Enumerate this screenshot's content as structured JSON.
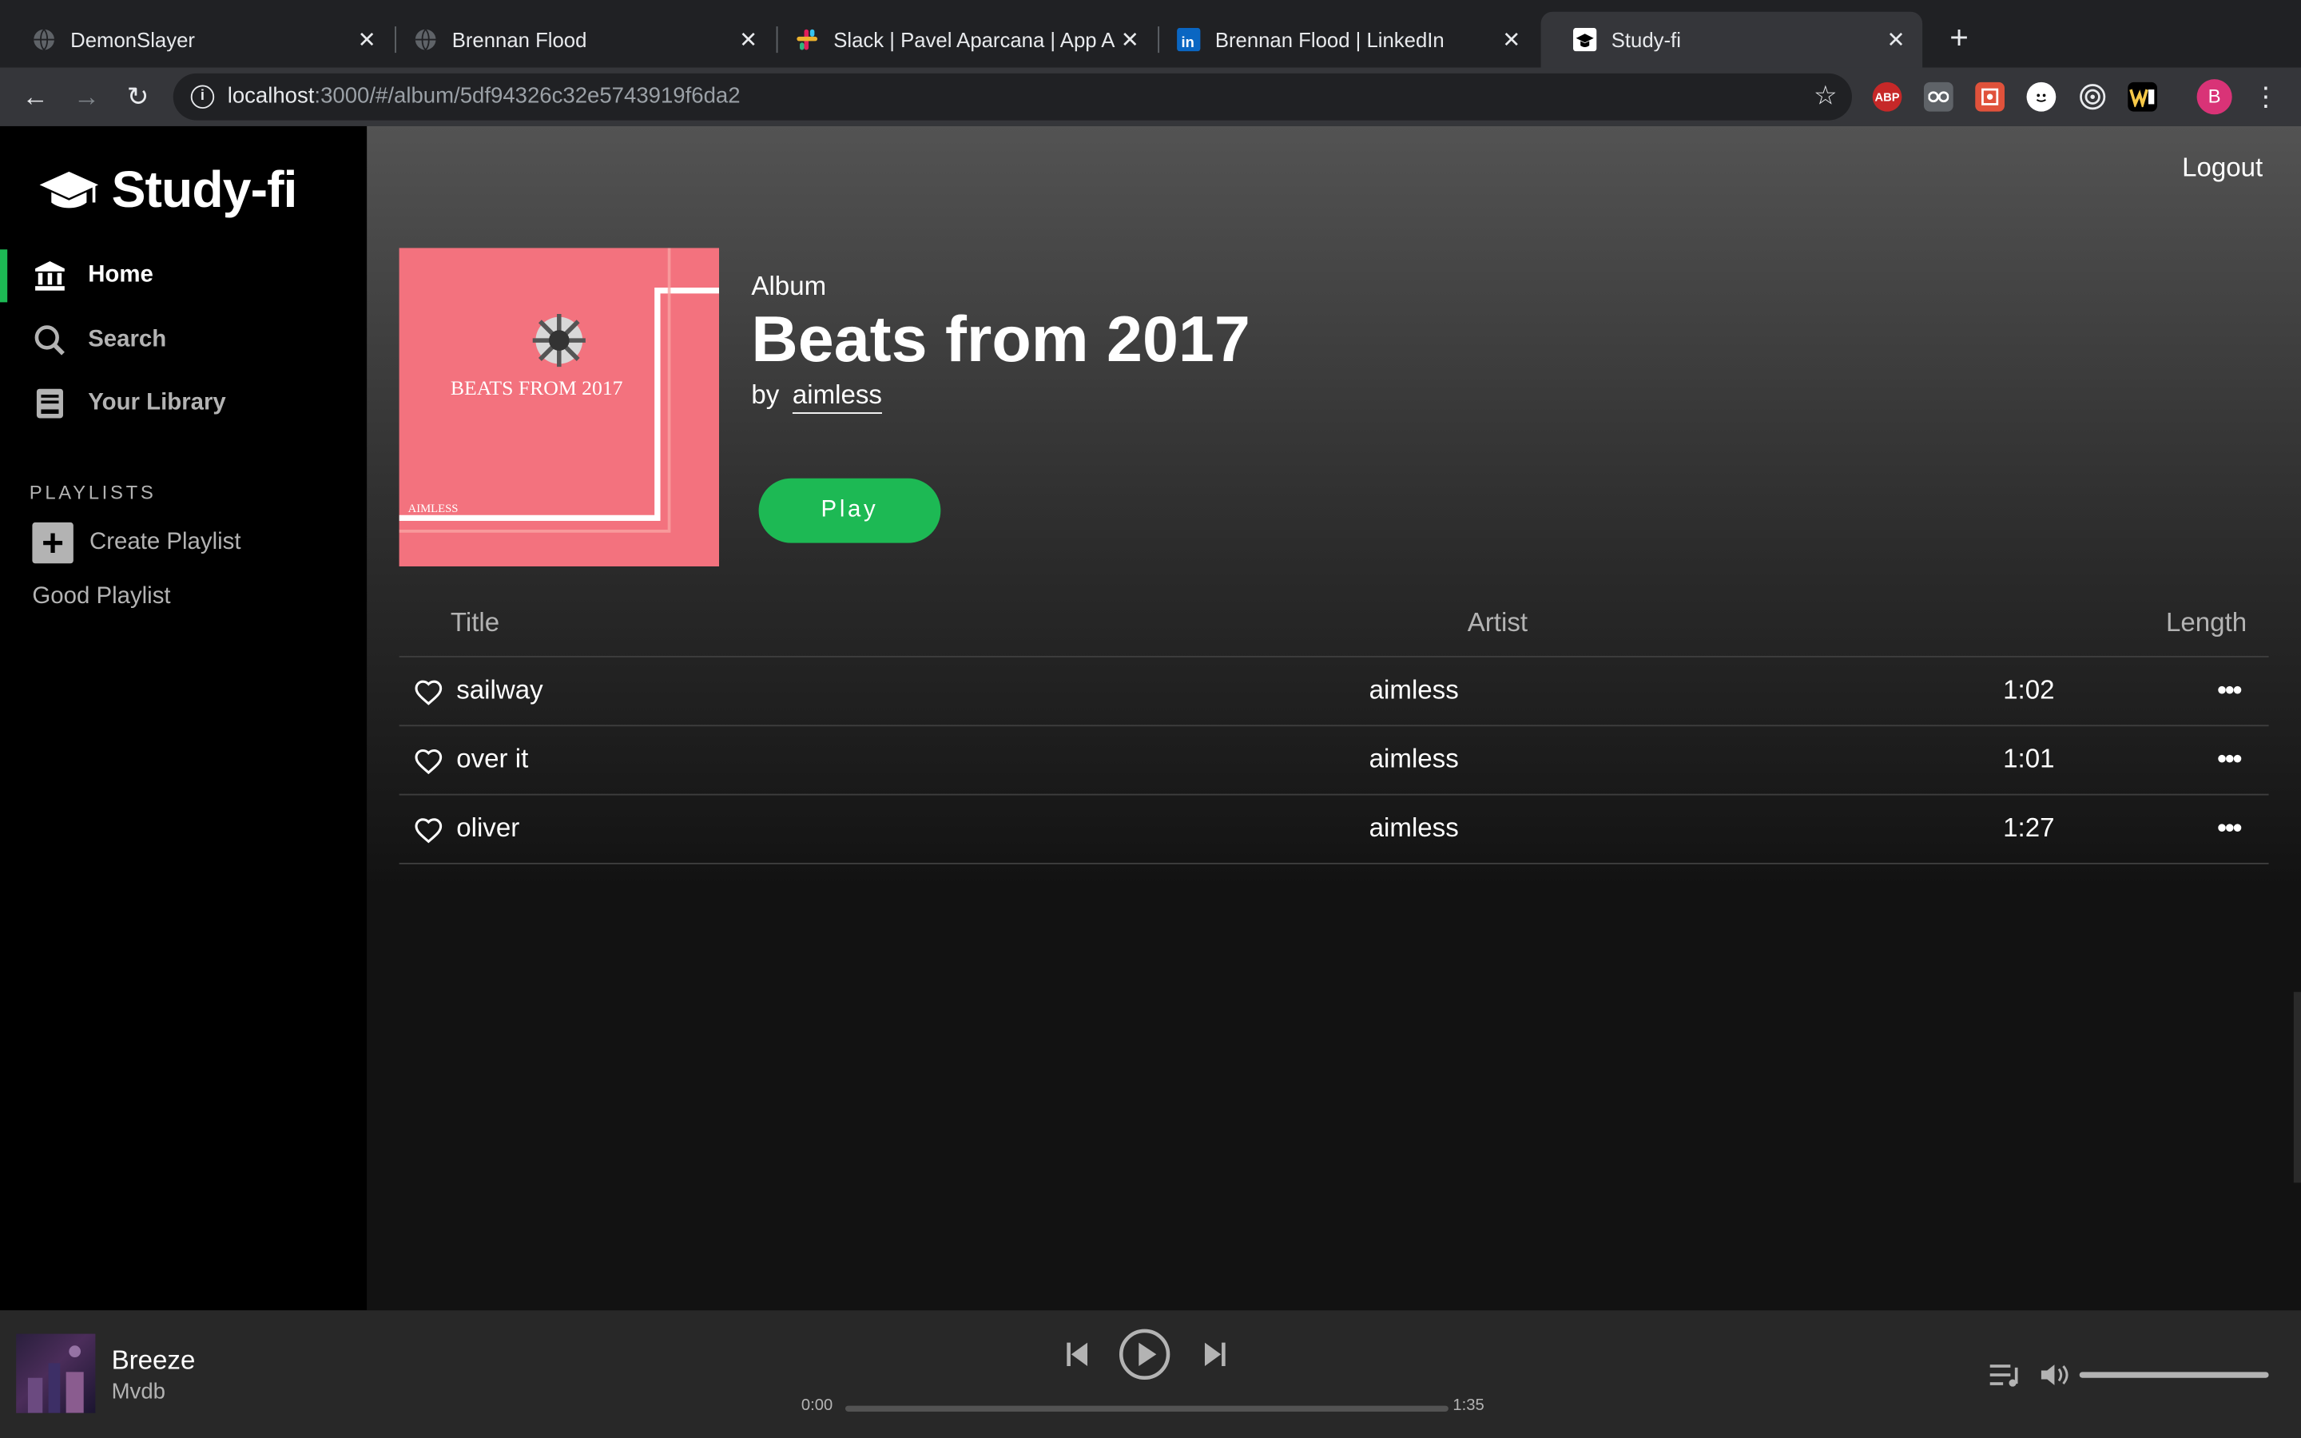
{
  "browser": {
    "tabs": [
      {
        "title": "DemonSlayer",
        "icon": "globe-icon"
      },
      {
        "title": "Brennan Flood",
        "icon": "globe-icon"
      },
      {
        "title": "Slack | Pavel Aparcana | App Ac",
        "icon": "slack-icon"
      },
      {
        "title": "Brennan Flood | LinkedIn",
        "icon": "linkedin-icon"
      },
      {
        "title": "Study-fi",
        "icon": "graduation-cap-icon",
        "active": true
      }
    ],
    "url_host": "localhost",
    "url_path": ":3000/#/album/5df94326c32e5743919f6da2",
    "extensions": [
      "adblock-icon",
      "extension-glasses-icon",
      "extension-puzzle-icon",
      "extension-face-icon",
      "extension-target-icon",
      "extension-w-icon"
    ],
    "adblock_label": "ABP",
    "profile_initial": "B"
  },
  "sidebar": {
    "brand": "Study-fi",
    "nav": [
      {
        "label": "Home",
        "icon": "bank-icon",
        "active": true
      },
      {
        "label": "Search",
        "icon": "search-icon"
      },
      {
        "label": "Your Library",
        "icon": "book-icon"
      }
    ],
    "playlists_heading": "PLAYLISTS",
    "create_playlist": "Create Playlist",
    "playlists": [
      "Good Playlist"
    ]
  },
  "header": {
    "logout": "Logout"
  },
  "album": {
    "type": "Album",
    "title": "Beats from 2017",
    "by": "by",
    "artist": "aimless",
    "play_label": "Play",
    "cover_text": "BEATS FROM 2017",
    "cover_artist": "AIMLESS"
  },
  "tracks_header": {
    "title": "Title",
    "artist": "Artist",
    "length": "Length"
  },
  "tracks": [
    {
      "title": "sailway",
      "artist": "aimless",
      "length": "1:02"
    },
    {
      "title": "over it",
      "artist": "aimless",
      "length": "1:01"
    },
    {
      "title": "oliver",
      "artist": "aimless",
      "length": "1:27"
    }
  ],
  "player": {
    "title": "Breeze",
    "artist": "Mvdb",
    "elapsed": "0:00",
    "duration": "1:35",
    "progress_fraction": 0.0,
    "volume_fraction": 1.0
  },
  "colors": {
    "accent": "#1db954",
    "sidebar_bg": "#000000",
    "player_bg": "#282828",
    "cover_bg": "#f3727e"
  }
}
